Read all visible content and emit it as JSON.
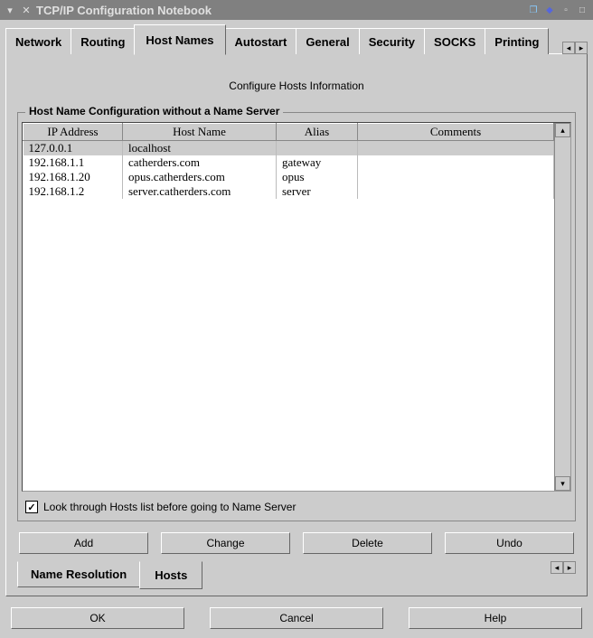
{
  "titlebar": {
    "title": "TCP/IP Configuration Notebook"
  },
  "topTabs": [
    {
      "label": "Network",
      "active": false
    },
    {
      "label": "Routing",
      "active": false
    },
    {
      "label": "Host Names",
      "active": true
    },
    {
      "label": "Autostart",
      "active": false
    },
    {
      "label": "General",
      "active": false
    },
    {
      "label": "Security",
      "active": false
    },
    {
      "label": "SOCKS",
      "active": false
    },
    {
      "label": "Printing",
      "active": false
    }
  ],
  "page": {
    "heading": "Configure Hosts Information",
    "fieldsetLegend": "Host Name Configuration without a Name Server",
    "columns": {
      "ip": "IP Address",
      "host": "Host Name",
      "alias": "Alias",
      "comments": "Comments"
    },
    "rows": [
      {
        "ip": "127.0.0.1",
        "host": "localhost",
        "alias": "",
        "comments": "",
        "selected": true
      },
      {
        "ip": "192.168.1.1",
        "host": "catherders.com",
        "alias": "gateway",
        "comments": "",
        "selected": false
      },
      {
        "ip": "192.168.1.20",
        "host": "opus.catherders.com",
        "alias": "opus",
        "comments": "",
        "selected": false
      },
      {
        "ip": "192.168.1.2",
        "host": "server.catherders.com",
        "alias": "server",
        "comments": "",
        "selected": false
      }
    ],
    "checkboxLabel": "Look through Hosts list before going to Name Server",
    "checkboxChecked": true,
    "buttons": {
      "add": "Add",
      "change": "Change",
      "delete": "Delete",
      "undo": "Undo"
    }
  },
  "subTabs": [
    {
      "label": "Name Resolution",
      "active": false
    },
    {
      "label": "Hosts",
      "active": true
    }
  ],
  "bottomButtons": {
    "ok": "OK",
    "cancel": "Cancel",
    "help": "Help"
  }
}
